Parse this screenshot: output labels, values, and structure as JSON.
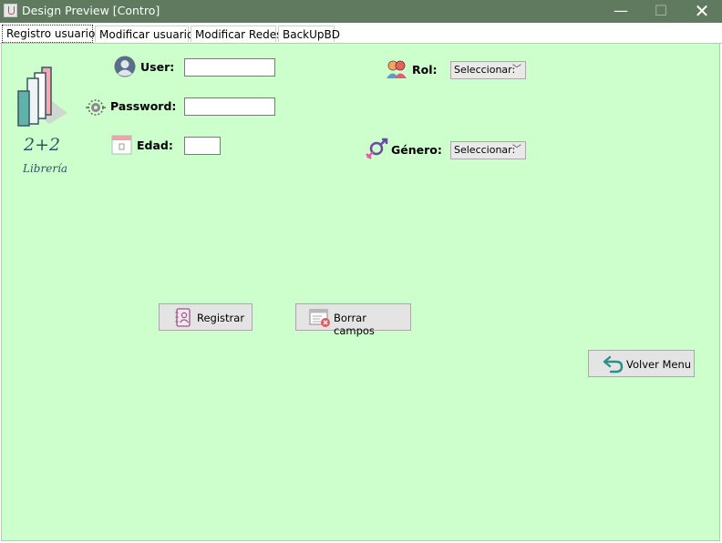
{
  "window": {
    "title": "Design Preview [Contro]",
    "minimize": "—",
    "maximize": "☐",
    "close": "✕"
  },
  "tabs": [
    {
      "label": "Registro usuarios"
    },
    {
      "label": "Modificar usuarios"
    },
    {
      "label": "Modificar Redes"
    },
    {
      "label": "BackUpBD"
    }
  ],
  "logo": {
    "line1": "2+2",
    "line2": "Librería"
  },
  "form": {
    "user_label": "User:",
    "password_label": "Password:",
    "edad_label": "Edad:",
    "rol_label": "Rol:",
    "genero_label": "Género:",
    "user_value": "",
    "password_value": "",
    "edad_value": "",
    "rol_selected": "Seleccionar:",
    "genero_selected": "Seleccionar:"
  },
  "buttons": {
    "registrar": "Registrar",
    "borrar": "Borrar campos",
    "volver": "Volver Menu"
  },
  "colors": {
    "panel": "#ccffcc",
    "titlebar": "#5f7a5e"
  }
}
